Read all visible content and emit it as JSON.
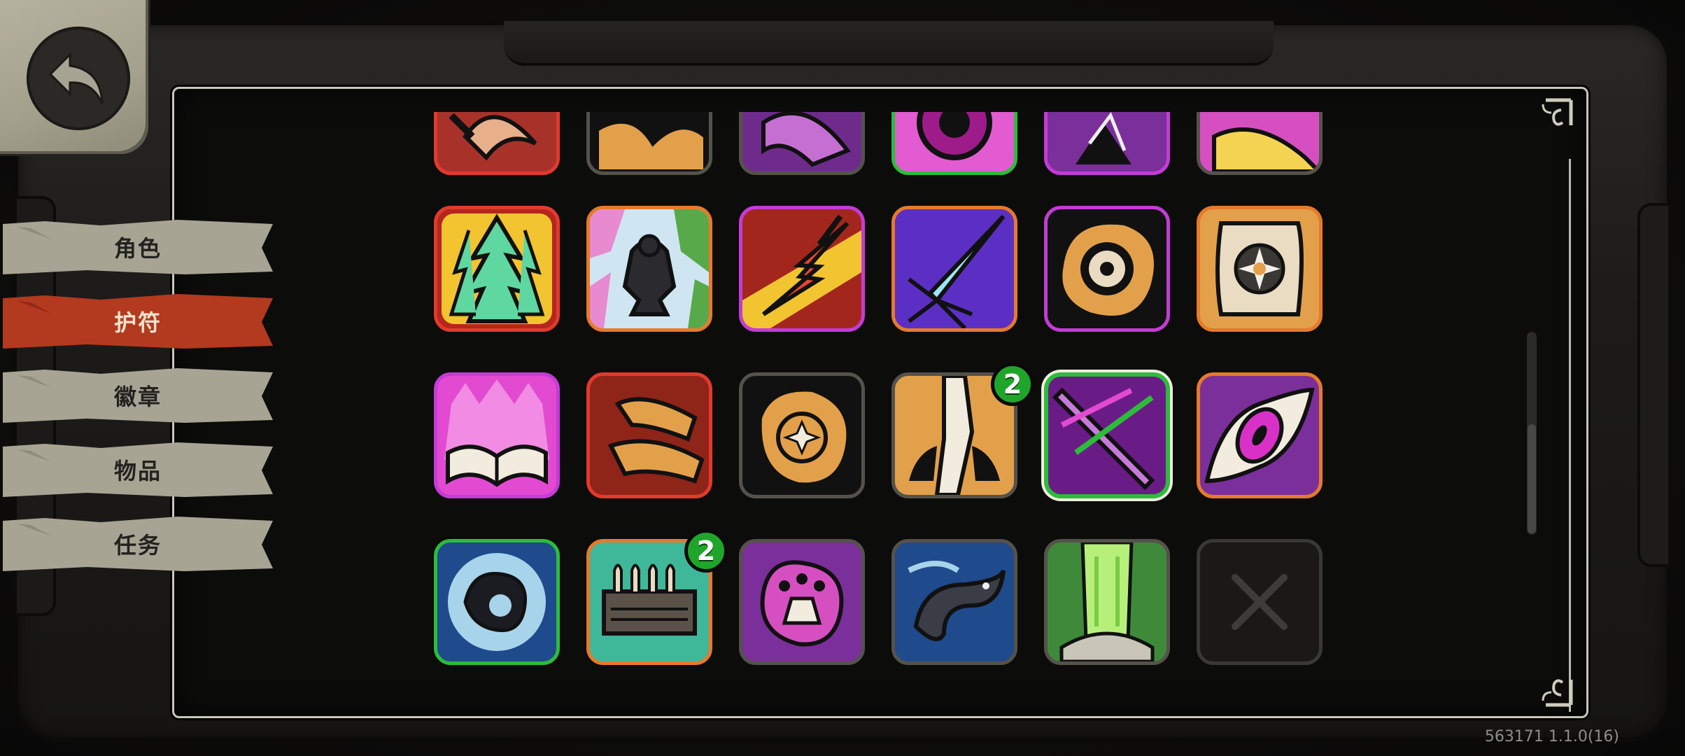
{
  "nav": {
    "back_icon": "back-arrow-icon",
    "tabs": [
      {
        "label": "角色",
        "active": false
      },
      {
        "label": "护符",
        "active": true
      },
      {
        "label": "徽章",
        "active": false
      },
      {
        "label": "物品",
        "active": false
      },
      {
        "label": "任务",
        "active": false
      }
    ]
  },
  "colors": {
    "active_tab": "#b3391f",
    "inactive_tab": "#a7a493",
    "badge_green": "#1fa62a",
    "rarity_red": "#e23a2e",
    "rarity_orange": "#e67a2b",
    "rarity_purple": "#c43bd6",
    "rarity_green": "#2bbd3a",
    "rarity_gray": "#55524c"
  },
  "charms": {
    "row_partial": [
      {
        "icon": "claw-charm-icon",
        "rarity": "red"
      },
      {
        "icon": "ornate-charm-icon",
        "rarity": "gray"
      },
      {
        "icon": "purple-beast-charm-icon",
        "rarity": "gray"
      },
      {
        "icon": "pink-eye-charm-icon",
        "rarity": "green"
      },
      {
        "icon": "shatter-charm-icon",
        "rarity": "purple"
      },
      {
        "icon": "yellow-flame-charm-icon",
        "rarity": "gray"
      }
    ],
    "row_1": [
      {
        "icon": "arrow-forest-charm-icon",
        "rarity": "red"
      },
      {
        "icon": "crouching-figure-charm-icon",
        "rarity": "orange"
      },
      {
        "icon": "lightning-charm-icon",
        "rarity": "purple"
      },
      {
        "icon": "ice-spear-charm-icon",
        "rarity": "orange"
      },
      {
        "icon": "spiral-eye-charm-icon",
        "rarity": "purple"
      },
      {
        "icon": "sun-gear-charm-icon",
        "rarity": "orange"
      }
    ],
    "row_2": [
      {
        "icon": "spellbook-charm-icon",
        "rarity": "purple"
      },
      {
        "icon": "fists-charm-icon",
        "rarity": "red"
      },
      {
        "icon": "gold-rune-charm-icon",
        "rarity": "gray"
      },
      {
        "icon": "claws-rising-charm-icon",
        "rarity": "gray",
        "badge": "2"
      },
      {
        "icon": "purple-slash-charm-icon",
        "rarity": "green",
        "selected": true
      },
      {
        "icon": "magenta-eye-charm-icon",
        "rarity": "orange"
      }
    ],
    "row_3": [
      {
        "icon": "shadow-burst-charm-icon",
        "rarity": "green"
      },
      {
        "icon": "bullet-rack-charm-icon",
        "rarity": "orange",
        "badge": "2"
      },
      {
        "icon": "paw-print-charm-icon",
        "rarity": "gray"
      },
      {
        "icon": "eel-charm-icon",
        "rarity": "gray"
      },
      {
        "icon": "green-waterfall-charm-icon",
        "rarity": "gray"
      },
      {
        "icon": "empty-slot-x-icon",
        "rarity": "empty"
      }
    ]
  },
  "footer": {
    "version": "563171 1.1.0(16)"
  }
}
